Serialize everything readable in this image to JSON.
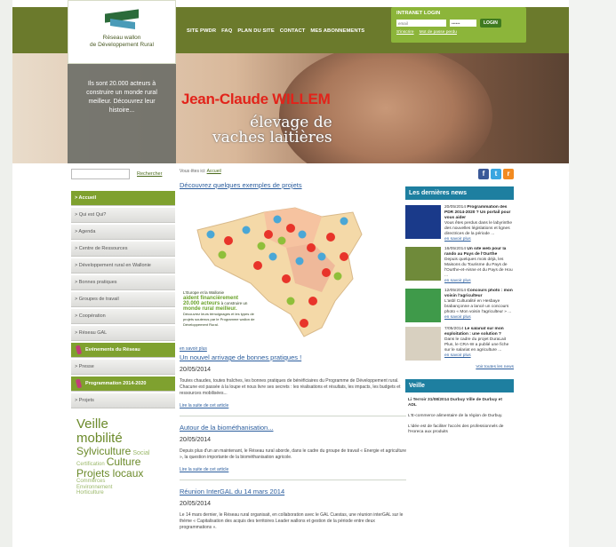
{
  "logo": {
    "line1": "Réseau wallon",
    "line2": "de Développement Rural"
  },
  "topnav": [
    "SITE PWDR",
    "FAQ",
    "PLAN DU SITE",
    "CONTACT",
    "MES ABONNEMENTS"
  ],
  "login": {
    "title": "INTRANET LOGIN",
    "email_placeholder": "email",
    "password_placeholder": "••••••",
    "button": "LOGIN",
    "register": "S'inscrire",
    "forgot": "Mot de passe perdu"
  },
  "hero": {
    "panel": "Ils sont 20.000 acteurs à construire un monde rural meilleur. Découvrez leur histoire...",
    "name": "Jean-Claude WILLEM",
    "subtitle_1": "élevage de",
    "subtitle_2": "vaches laitières"
  },
  "search": {
    "placeholder": "",
    "button": "Rechercher"
  },
  "menu": [
    {
      "label": "> Accueil",
      "style": "active"
    },
    {
      "label": "> Qui est Qui?",
      "style": ""
    },
    {
      "label": "> Agenda",
      "style": ""
    },
    {
      "label": "> Centre de Ressources",
      "style": ""
    },
    {
      "label": "> Développement rural en Wallonie",
      "style": ""
    },
    {
      "label": "> Bonnes pratiques",
      "style": ""
    },
    {
      "label": "> Groupes de travail",
      "style": ""
    },
    {
      "label": "> Coopération",
      "style": ""
    },
    {
      "label": "> Réseau GAL",
      "style": ""
    },
    {
      "label": "Evénements du Réseau",
      "style": "green"
    },
    {
      "label": "> Presse",
      "style": ""
    },
    {
      "label": "Programmation 2014-2020",
      "style": "green"
    },
    {
      "label": "> Projets",
      "style": ""
    }
  ],
  "tags": [
    {
      "text": "Veille",
      "size": 15
    },
    {
      "text": "mobilité",
      "size": 15
    },
    {
      "text": "Sylviculture",
      "size": 12
    },
    {
      "text": "Social",
      "size": 7
    },
    {
      "text": "Certification",
      "size": 6
    },
    {
      "text": "Culture",
      "size": 12
    },
    {
      "text": "Projets locaux",
      "size": 12
    },
    {
      "text": "Commerces",
      "size": 6
    },
    {
      "text": "Environnement",
      "size": 6
    },
    {
      "text": "Horticulture",
      "size": 6
    }
  ],
  "content": {
    "breadcrumb_prefix": "Vous êtes ici:",
    "breadcrumb_link": "Accueil",
    "heading": "Découvrez quelques exemples de projets",
    "map_line1": "L'Europe et la Wallonie",
    "map_line2": "aident financièrement",
    "map_line3": "20.000 acteurs",
    "map_line4": "à construire un",
    "map_line5": "monde rural meilleur.",
    "map_line6": "Découvrez leurs témoignages et les types de projets soutenus par le Programme wallon de Développement Rural.",
    "more": "en savoir plus",
    "articles": [
      {
        "title": "Un nouvel arrivage de bonnes pratiques !",
        "date": "20/05/2014",
        "text": "Toutes chaudes, toutes fraîches, les bonnes pratiques de bénéficiaires du Programme de Développement rural. Chacune est passée à la loupe et nous livre ses secrets : les réalisations et résultats, les impacts, les budgets et ressources mobilisées...",
        "read": "Lire la suite de cet article"
      },
      {
        "title": "Autour de la biométhanisation...",
        "date": "20/05/2014",
        "text": "Depuis plus d'un an maintenant, le Réseau rural aborde, dans le cadre du groupe de travail « Energie et agriculture », la question importante de la biométhanisation agricole.",
        "read": "Lire la suite de cet article"
      },
      {
        "title": "Réunion InterGAL du 14 mars 2014",
        "date": "20/05/2014",
        "text": "Le 14 mars dernier, le Réseau rural organisait, en collaboration avec le GAL Cuestas, une réunion interGAL sur le thème « Capitalisation des acquis des territoires Leader wallons et gestion de la période entre deux programmations ».",
        "read": ""
      }
    ]
  },
  "social": {
    "facebook": "f",
    "twitter": "t",
    "rss": "r"
  },
  "news": {
    "heading": "Les dernières news",
    "items": [
      {
        "date": "20/05/2014",
        "title": "Programmation des PDR 2014-2020 ? Un portail pour vous aider",
        "text": "Vous êtes perdus dans le labyrinthe des nouvelles législations et lignes directrices de la période ...",
        "more": "en savoir plus",
        "color": "#1a3a8a"
      },
      {
        "date": "16/05/2014",
        "title": "Un site web pour la rando au Pays de l'Ourthe",
        "text": "Depuis quelques mois déjà, les Maisons du Tourisme du Pays de l'Ourthe-et-Aisne et du Pays de Hou ...",
        "more": "en savoir plus",
        "color": "#6f8a3a"
      },
      {
        "date": "12/05/2014",
        "title": "Concours photo : mon voisin l'agriculteur",
        "text": "L'asbl Culturalité en Hesbaye brabançonne a lancé un concours photo « Mon voisin l'agriculteur » ...",
        "more": "en savoir plus",
        "color": "#3f9a4a"
      },
      {
        "date": "7/05/2014",
        "title": "Le salariat sur mon exploitation : une solution ?",
        "text": "Dans le cadre du projet DuraLait Plus, le CRA-W a publié une fiche sur le salariat en agriculture ...",
        "more": "en savoir plus",
        "color": "#d8d0c0"
      }
    ],
    "all": "Voir toutes les news"
  },
  "veille": {
    "heading": "Veille",
    "title": "Li Terroir 31/08/2014 Durbuy Ville de Durbuy et ADL",
    "text1": "L'E-commerce alimentaire de la région de Durbuy.",
    "text2": "L'idée est de faciliter l'accès des professionnels de l'Horeca aux produits"
  }
}
